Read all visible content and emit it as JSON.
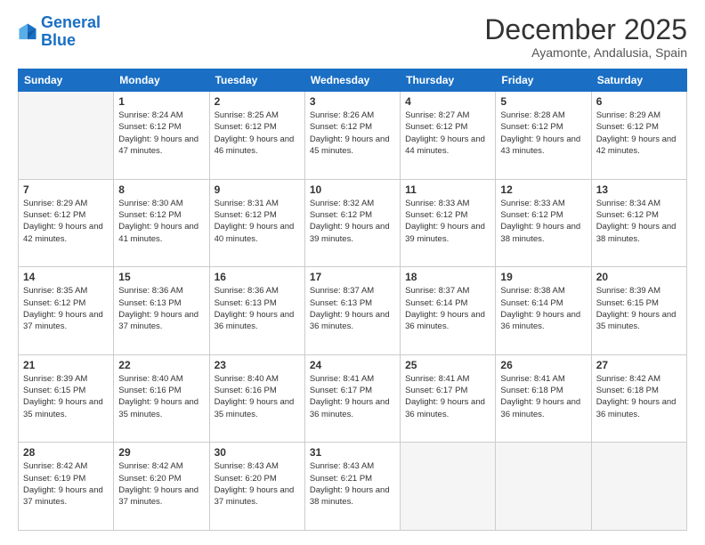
{
  "logo": {
    "line1": "General",
    "line2": "Blue"
  },
  "title": "December 2025",
  "subtitle": "Ayamonte, Andalusia, Spain",
  "days_header": [
    "Sunday",
    "Monday",
    "Tuesday",
    "Wednesday",
    "Thursday",
    "Friday",
    "Saturday"
  ],
  "weeks": [
    [
      {
        "num": "",
        "sunrise": "",
        "sunset": "",
        "daylight": ""
      },
      {
        "num": "1",
        "sunrise": "Sunrise: 8:24 AM",
        "sunset": "Sunset: 6:12 PM",
        "daylight": "Daylight: 9 hours and 47 minutes."
      },
      {
        "num": "2",
        "sunrise": "Sunrise: 8:25 AM",
        "sunset": "Sunset: 6:12 PM",
        "daylight": "Daylight: 9 hours and 46 minutes."
      },
      {
        "num": "3",
        "sunrise": "Sunrise: 8:26 AM",
        "sunset": "Sunset: 6:12 PM",
        "daylight": "Daylight: 9 hours and 45 minutes."
      },
      {
        "num": "4",
        "sunrise": "Sunrise: 8:27 AM",
        "sunset": "Sunset: 6:12 PM",
        "daylight": "Daylight: 9 hours and 44 minutes."
      },
      {
        "num": "5",
        "sunrise": "Sunrise: 8:28 AM",
        "sunset": "Sunset: 6:12 PM",
        "daylight": "Daylight: 9 hours and 43 minutes."
      },
      {
        "num": "6",
        "sunrise": "Sunrise: 8:29 AM",
        "sunset": "Sunset: 6:12 PM",
        "daylight": "Daylight: 9 hours and 42 minutes."
      }
    ],
    [
      {
        "num": "7",
        "sunrise": "Sunrise: 8:29 AM",
        "sunset": "Sunset: 6:12 PM",
        "daylight": "Daylight: 9 hours and 42 minutes."
      },
      {
        "num": "8",
        "sunrise": "Sunrise: 8:30 AM",
        "sunset": "Sunset: 6:12 PM",
        "daylight": "Daylight: 9 hours and 41 minutes."
      },
      {
        "num": "9",
        "sunrise": "Sunrise: 8:31 AM",
        "sunset": "Sunset: 6:12 PM",
        "daylight": "Daylight: 9 hours and 40 minutes."
      },
      {
        "num": "10",
        "sunrise": "Sunrise: 8:32 AM",
        "sunset": "Sunset: 6:12 PM",
        "daylight": "Daylight: 9 hours and 39 minutes."
      },
      {
        "num": "11",
        "sunrise": "Sunrise: 8:33 AM",
        "sunset": "Sunset: 6:12 PM",
        "daylight": "Daylight: 9 hours and 39 minutes."
      },
      {
        "num": "12",
        "sunrise": "Sunrise: 8:33 AM",
        "sunset": "Sunset: 6:12 PM",
        "daylight": "Daylight: 9 hours and 38 minutes."
      },
      {
        "num": "13",
        "sunrise": "Sunrise: 8:34 AM",
        "sunset": "Sunset: 6:12 PM",
        "daylight": "Daylight: 9 hours and 38 minutes."
      }
    ],
    [
      {
        "num": "14",
        "sunrise": "Sunrise: 8:35 AM",
        "sunset": "Sunset: 6:12 PM",
        "daylight": "Daylight: 9 hours and 37 minutes."
      },
      {
        "num": "15",
        "sunrise": "Sunrise: 8:36 AM",
        "sunset": "Sunset: 6:13 PM",
        "daylight": "Daylight: 9 hours and 37 minutes."
      },
      {
        "num": "16",
        "sunrise": "Sunrise: 8:36 AM",
        "sunset": "Sunset: 6:13 PM",
        "daylight": "Daylight: 9 hours and 36 minutes."
      },
      {
        "num": "17",
        "sunrise": "Sunrise: 8:37 AM",
        "sunset": "Sunset: 6:13 PM",
        "daylight": "Daylight: 9 hours and 36 minutes."
      },
      {
        "num": "18",
        "sunrise": "Sunrise: 8:37 AM",
        "sunset": "Sunset: 6:14 PM",
        "daylight": "Daylight: 9 hours and 36 minutes."
      },
      {
        "num": "19",
        "sunrise": "Sunrise: 8:38 AM",
        "sunset": "Sunset: 6:14 PM",
        "daylight": "Daylight: 9 hours and 36 minutes."
      },
      {
        "num": "20",
        "sunrise": "Sunrise: 8:39 AM",
        "sunset": "Sunset: 6:15 PM",
        "daylight": "Daylight: 9 hours and 35 minutes."
      }
    ],
    [
      {
        "num": "21",
        "sunrise": "Sunrise: 8:39 AM",
        "sunset": "Sunset: 6:15 PM",
        "daylight": "Daylight: 9 hours and 35 minutes."
      },
      {
        "num": "22",
        "sunrise": "Sunrise: 8:40 AM",
        "sunset": "Sunset: 6:16 PM",
        "daylight": "Daylight: 9 hours and 35 minutes."
      },
      {
        "num": "23",
        "sunrise": "Sunrise: 8:40 AM",
        "sunset": "Sunset: 6:16 PM",
        "daylight": "Daylight: 9 hours and 35 minutes."
      },
      {
        "num": "24",
        "sunrise": "Sunrise: 8:41 AM",
        "sunset": "Sunset: 6:17 PM",
        "daylight": "Daylight: 9 hours and 36 minutes."
      },
      {
        "num": "25",
        "sunrise": "Sunrise: 8:41 AM",
        "sunset": "Sunset: 6:17 PM",
        "daylight": "Daylight: 9 hours and 36 minutes."
      },
      {
        "num": "26",
        "sunrise": "Sunrise: 8:41 AM",
        "sunset": "Sunset: 6:18 PM",
        "daylight": "Daylight: 9 hours and 36 minutes."
      },
      {
        "num": "27",
        "sunrise": "Sunrise: 8:42 AM",
        "sunset": "Sunset: 6:18 PM",
        "daylight": "Daylight: 9 hours and 36 minutes."
      }
    ],
    [
      {
        "num": "28",
        "sunrise": "Sunrise: 8:42 AM",
        "sunset": "Sunset: 6:19 PM",
        "daylight": "Daylight: 9 hours and 37 minutes."
      },
      {
        "num": "29",
        "sunrise": "Sunrise: 8:42 AM",
        "sunset": "Sunset: 6:20 PM",
        "daylight": "Daylight: 9 hours and 37 minutes."
      },
      {
        "num": "30",
        "sunrise": "Sunrise: 8:43 AM",
        "sunset": "Sunset: 6:20 PM",
        "daylight": "Daylight: 9 hours and 37 minutes."
      },
      {
        "num": "31",
        "sunrise": "Sunrise: 8:43 AM",
        "sunset": "Sunset: 6:21 PM",
        "daylight": "Daylight: 9 hours and 38 minutes."
      },
      {
        "num": "",
        "sunrise": "",
        "sunset": "",
        "daylight": ""
      },
      {
        "num": "",
        "sunrise": "",
        "sunset": "",
        "daylight": ""
      },
      {
        "num": "",
        "sunrise": "",
        "sunset": "",
        "daylight": ""
      }
    ]
  ]
}
